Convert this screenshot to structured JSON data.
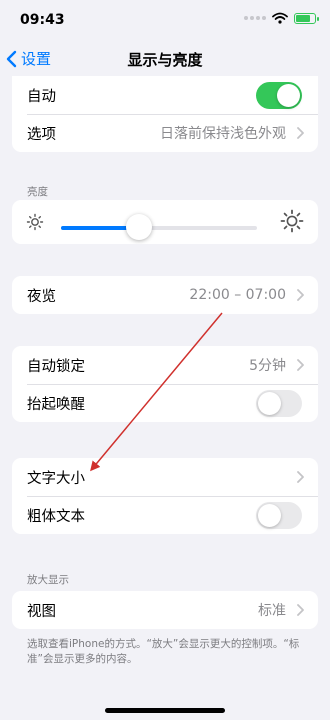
{
  "status": {
    "time": "09:43",
    "battery_level": 0.8
  },
  "nav": {
    "back_label": "设置",
    "title": "显示与亮度"
  },
  "appearance": {
    "auto_label": "自动",
    "auto_on": true,
    "options_label": "选项",
    "options_value": "日落前保持浅色外观"
  },
  "brightness": {
    "header": "亮度",
    "level": 0.4
  },
  "night_shift": {
    "label": "夜览",
    "value": "22:00 – 07:00"
  },
  "lock": {
    "auto_lock_label": "自动锁定",
    "auto_lock_value": "5分钟",
    "raise_to_wake_label": "抬起唤醒",
    "raise_to_wake_on": false
  },
  "text": {
    "text_size_label": "文字大小",
    "bold_text_label": "粗体文本",
    "bold_text_on": false
  },
  "zoom": {
    "header": "放大显示",
    "view_label": "视图",
    "view_value": "标准",
    "footnote": "选取查看iPhone的方式。“放大”会显示更大的控制项。“标准”会显示更多的内容。"
  },
  "colors": {
    "accent": "#007aff",
    "toggle_on": "#34c759",
    "annotation": "#d0312d"
  }
}
